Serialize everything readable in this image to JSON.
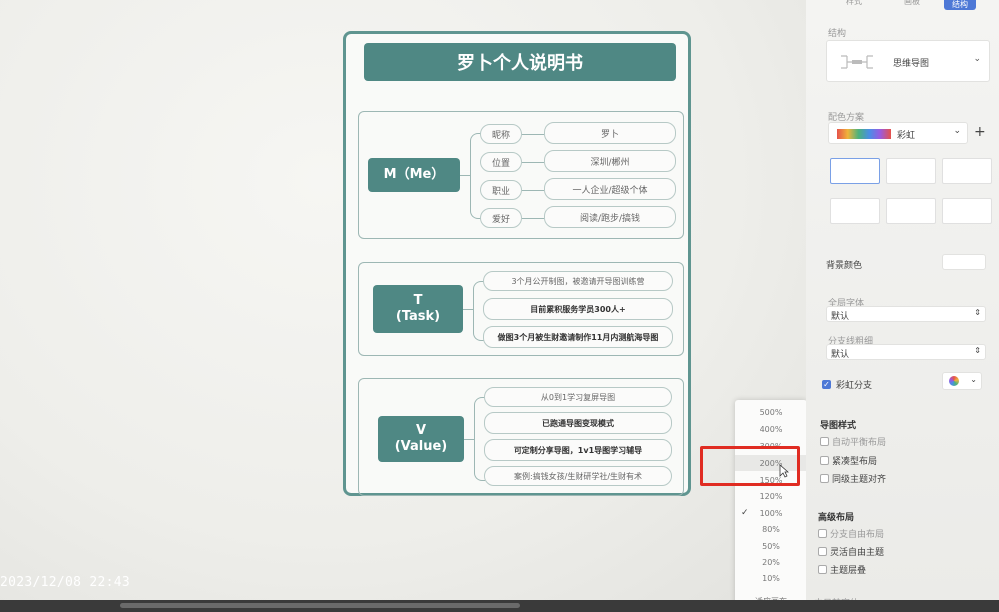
{
  "mindmap": {
    "title": "罗卜个人说明书",
    "me": {
      "root": "M（Me）",
      "items": [
        {
          "key": "昵称",
          "value": "罗卜"
        },
        {
          "key": "位置",
          "value": "深圳/郴州"
        },
        {
          "key": "职业",
          "value": "一人企业/超级个体"
        },
        {
          "key": "爱好",
          "value": "阅读/跑步/搞钱"
        }
      ]
    },
    "task": {
      "root_line1": "T",
      "root_line2": "(Task)",
      "items": [
        "3个月公开制图，被邀请开导图训练营",
        "目前累积服务学员300人+",
        "做图3个月被生财邀请制作11月内测航海导图"
      ]
    },
    "value": {
      "root_line1": "V",
      "root_line2": "(Value)",
      "items": [
        "从0到1学习复屏导图",
        "已跑通导图变现模式",
        "可定制分享导图，1v1导图学习辅导",
        "案例:搞钱女孩/生财研学社/生财有术"
      ]
    }
  },
  "zoom_menu": {
    "options": [
      "500%",
      "400%",
      "300%",
      "200%",
      "150%",
      "120%",
      "100%",
      "80%",
      "50%",
      "20%",
      "10%"
    ],
    "selected": "100%",
    "hovered": "200%",
    "fit": "适应画布"
  },
  "panel": {
    "tabs": [
      "样式",
      "画板",
      "结构"
    ],
    "active_tab": "结构",
    "structure_label": "结构",
    "structure_value": "思维导图",
    "color_scheme_label": "配色方案",
    "color_scheme_value": "彩虹",
    "add_label": "+",
    "bg_color_label": "背景颜色",
    "global_font_label": "全局字体",
    "global_font_value": "默认",
    "branch_line_label": "分支线粗细",
    "branch_line_value": "默认",
    "rainbow_branch_label": "彩虹分支",
    "map_style_head": "导图样式",
    "auto_balance": "自动平衡布局",
    "compact_layout": "紧凑型布局",
    "same_level_align": "同级主题对齐",
    "advanced_head": "高级布局",
    "branch_free": "分支自由布局",
    "flexible_free": "灵活自由主题",
    "topic_stack": "主题层叠",
    "bottom_label": "中日韩字体"
  },
  "timestamp": "2023/12/08 22:43",
  "colors": {
    "teal": "#4f8884",
    "highlight": "#e02c22",
    "accent": "#4d78d6"
  }
}
